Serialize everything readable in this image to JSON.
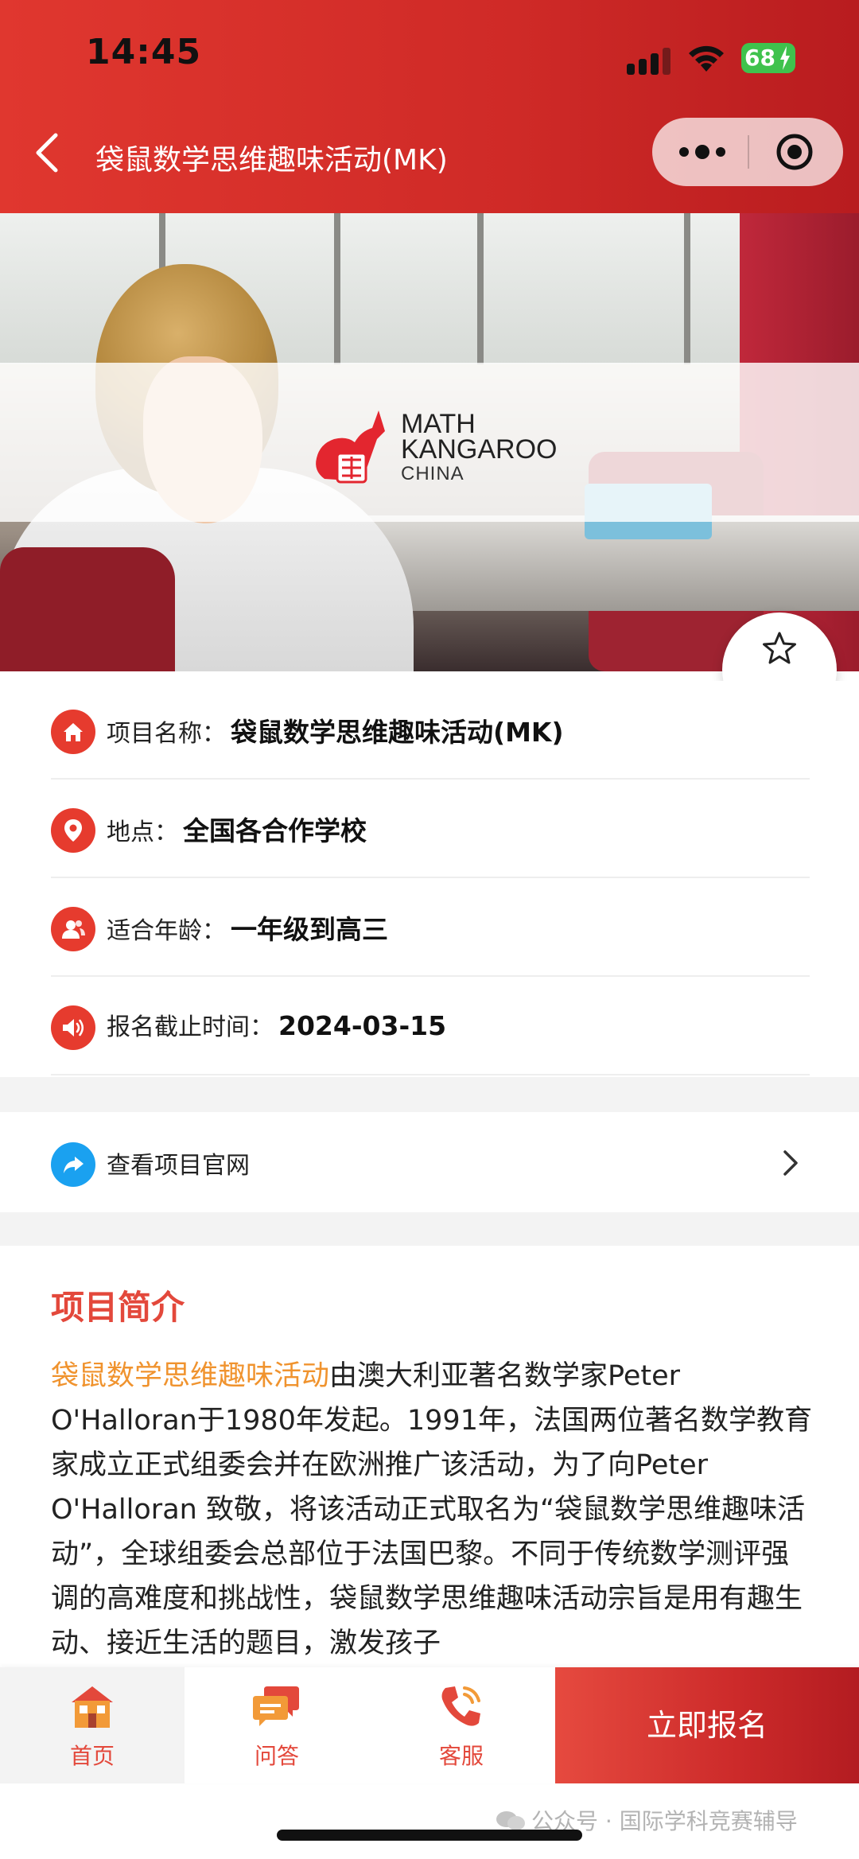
{
  "status_bar": {
    "time": "14:45",
    "battery": "68"
  },
  "nav": {
    "title": "袋鼠数学思维趣味活动(MK)"
  },
  "hero": {
    "logo_lines": [
      "MATH",
      "KANGAROO",
      "CHINA"
    ]
  },
  "favorite": {
    "label": "收藏"
  },
  "info": {
    "rows": [
      {
        "label": "项目名称：",
        "value": "袋鼠数学思维趣味活动(MK)",
        "icon": "home-icon"
      },
      {
        "label": "地点：",
        "value": "全国各合作学校",
        "icon": "location-pin-icon"
      },
      {
        "label": "适合年龄：",
        "value": "一年级到高三",
        "icon": "people-icon"
      },
      {
        "label": "报名截止时间：",
        "value": "2024-03-15",
        "icon": "speaker-icon"
      }
    ]
  },
  "site_link": {
    "label": "查看项目官网",
    "icon": "share-arrow-icon"
  },
  "intro": {
    "heading": "项目简介",
    "highlight": "袋鼠数学思维趣味活动",
    "body": "由澳大利亚著名数学家Peter O'Halloran于1980年发起。1991年，法国两位著名数学教育家成立正式组委会并在欧洲推广该活动，为了向Peter O'Halloran 致敬，将该活动正式取名为“袋鼠数学思维趣味活动”，全球组委会总部位于法国巴黎。不同于传统数学测评强调的高难度和挑战性，袋鼠数学思维趣味活动宗旨是用有趣生动、接近生活的题目，激发孩子"
  },
  "tabbar": {
    "tabs": [
      {
        "label": "首页",
        "icon": "house-icon"
      },
      {
        "label": "问答",
        "icon": "chat-bubbles-icon"
      },
      {
        "label": "客服",
        "icon": "phone-icon"
      }
    ],
    "signup": "立即报名"
  },
  "watermark": "公众号 · 国际学科竞赛辅导",
  "colors": {
    "brand_red": "#e0372f",
    "highlight_orange": "#f0932e",
    "link_blue": "#1aa1f0"
  }
}
